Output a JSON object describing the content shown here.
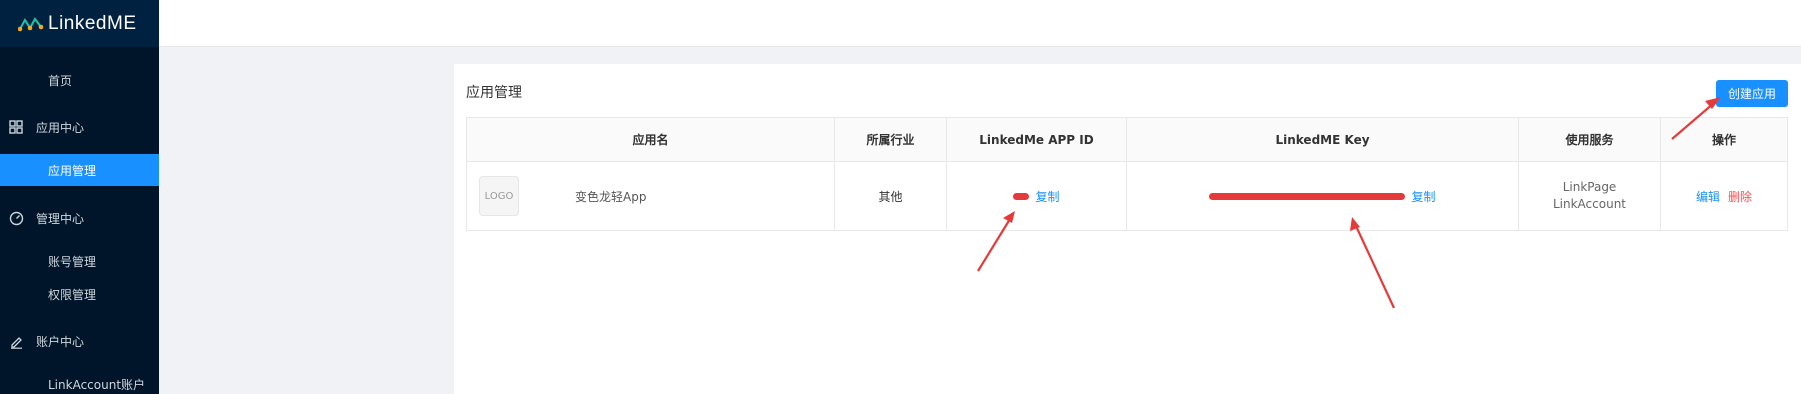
{
  "brand": {
    "name_prefix": "L",
    "name_mid": "inked",
    "name_suffix": "ME"
  },
  "sidebar": {
    "items": [
      {
        "label": "首页",
        "icon": ""
      },
      {
        "label": "应用中心",
        "icon": "grid-icon"
      },
      {
        "label": "应用管理",
        "icon": "",
        "active": true
      },
      {
        "label": "管理中心",
        "icon": "dashboard-icon"
      },
      {
        "label": "账号管理",
        "icon": ""
      },
      {
        "label": "权限管理",
        "icon": ""
      },
      {
        "label": "账户中心",
        "icon": "edit-icon"
      },
      {
        "label": "LinkAccount账户",
        "icon": ""
      }
    ]
  },
  "page": {
    "title": "应用管理",
    "create_button": "创建应用"
  },
  "table": {
    "headers": [
      "应用名",
      "所属行业",
      "LinkedMe APP ID",
      "LinkedME Key",
      "使用服务",
      "操作"
    ],
    "rows": [
      {
        "logo": "LOGO",
        "name": "变色龙轻App",
        "industry": "其他",
        "copy_label": "复制",
        "services": [
          "LinkPage",
          "LinkAccount"
        ],
        "edit_label": "编辑",
        "delete_label": "删除"
      }
    ]
  },
  "colors": {
    "sidebar_bg": "#001529",
    "accent": "#1890ff",
    "danger": "#ff4d4f",
    "annotation": "#e63a3a"
  }
}
